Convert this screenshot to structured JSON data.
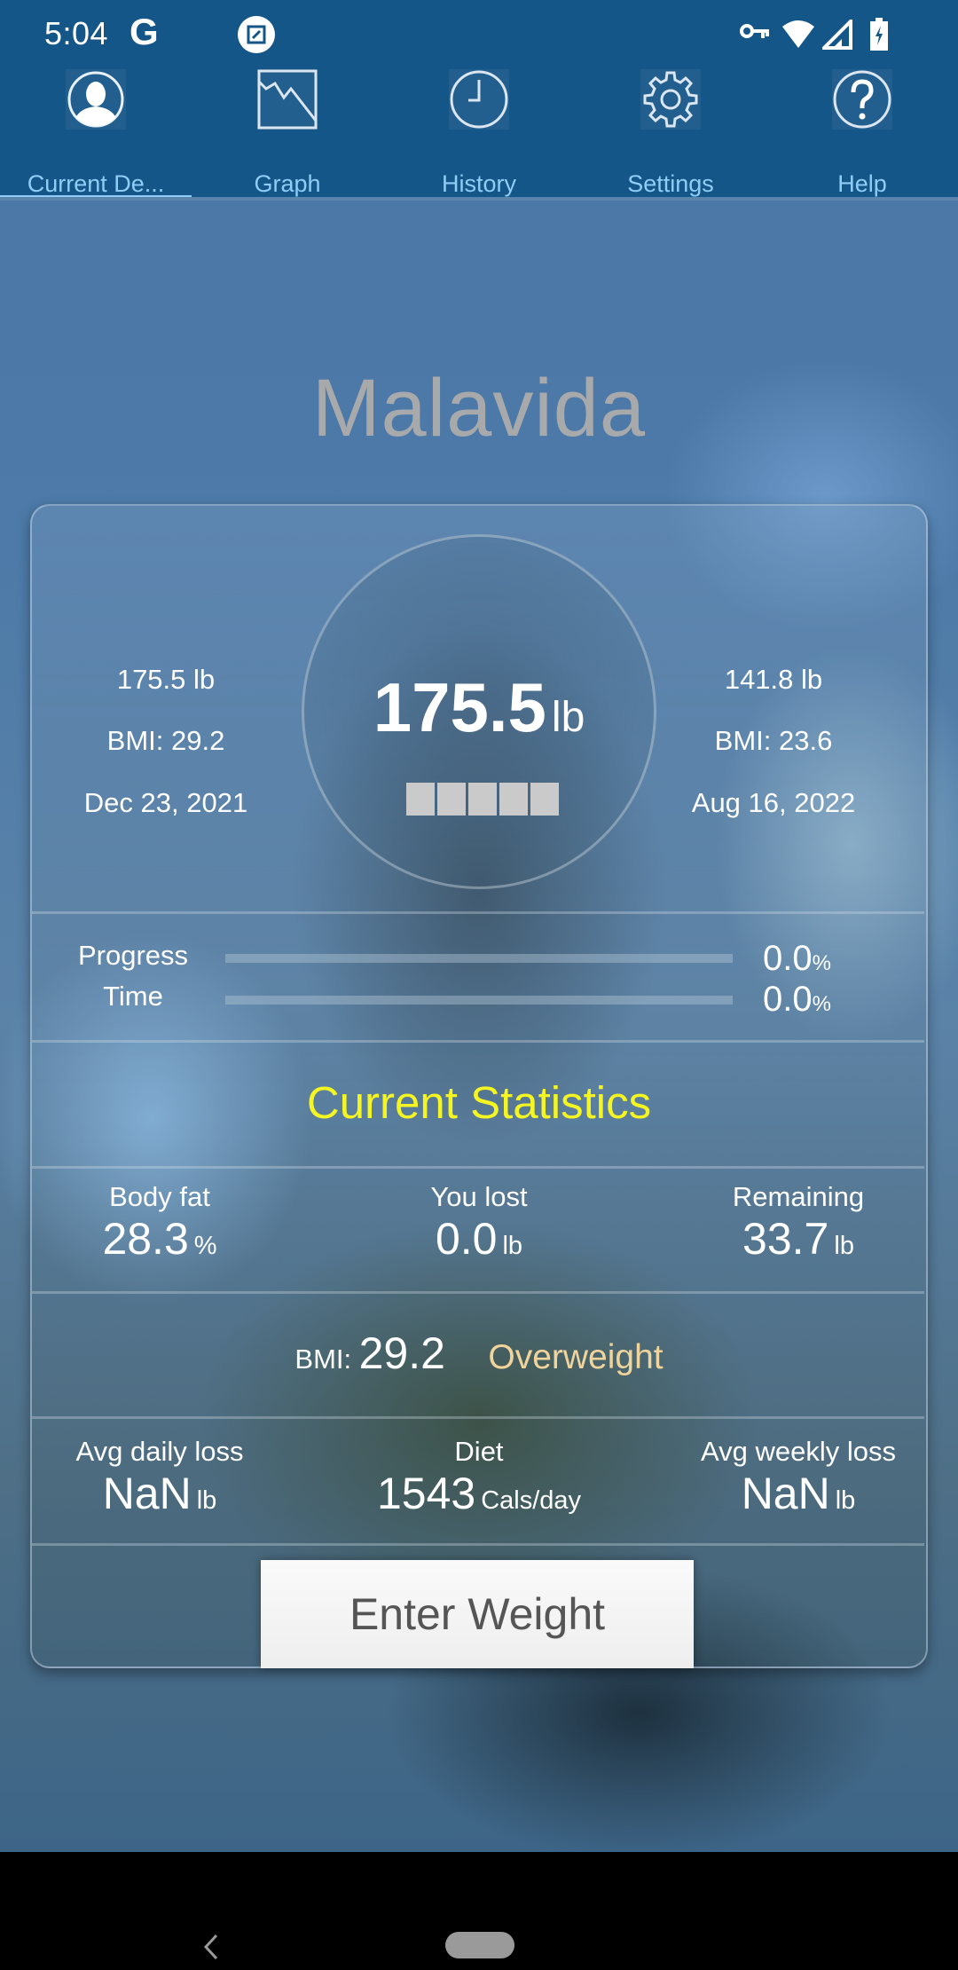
{
  "status_bar": {
    "time": "5:04",
    "left_icons": [
      "google-g-icon",
      "screenshot-edit-icon"
    ],
    "right_icons": [
      "vpn-key-icon",
      "wifi-icon",
      "cell-signal-icon",
      "battery-charging-icon"
    ],
    "google_glyph": "G"
  },
  "tabs": [
    {
      "label": "Current De...",
      "icon": "user-profile-icon",
      "active": true
    },
    {
      "label": "Graph",
      "icon": "line-graph-icon",
      "active": false
    },
    {
      "label": "History",
      "icon": "clock-icon",
      "active": false
    },
    {
      "label": "Settings",
      "icon": "gear-icon",
      "active": false
    },
    {
      "label": "Help",
      "icon": "help-icon",
      "active": false
    }
  ],
  "profile": {
    "name": "Malavida"
  },
  "summary": {
    "start": {
      "weight": "175.5 lb",
      "bmi": "BMI: 29.2",
      "date": "Dec 23, 2021"
    },
    "current": {
      "weight": "175.5",
      "unit": "lb",
      "blocks": 5
    },
    "goal": {
      "weight": "141.8 lb",
      "bmi": "BMI: 23.6",
      "date": "Aug 16, 2022"
    }
  },
  "progress": {
    "rows": [
      {
        "label": "Progress",
        "value": "0.0",
        "unit": "%",
        "fraction": 0.0
      },
      {
        "label": "Time",
        "value": "0.0",
        "unit": "%",
        "fraction": 0.0
      }
    ]
  },
  "stats": {
    "title": "Current Statistics",
    "body_fat": {
      "label": "Body fat",
      "value": "28.3",
      "unit": "%"
    },
    "you_lost": {
      "label": "You lost",
      "value": "0.0",
      "unit": "lb"
    },
    "remaining": {
      "label": "Remaining",
      "value": "33.7",
      "unit": "lb"
    },
    "bmi": {
      "label": "BMI:",
      "value": "29.2",
      "category": "Overweight"
    },
    "avg_daily_loss": {
      "label": "Avg daily loss",
      "value": "NaN",
      "unit": "lb"
    },
    "diet": {
      "label": "Diet",
      "value": "1543",
      "unit": "Cals/day"
    },
    "avg_weekly_loss": {
      "label": "Avg weekly loss",
      "value": "NaN",
      "unit": "lb"
    }
  },
  "actions": {
    "enter_weight_label": "Enter Weight"
  },
  "colors": {
    "header": "#155689",
    "tab_text": "#8fcdf6",
    "section_title": "#f5f522",
    "bmi_category": "#f1d49b",
    "title_text": "#a7a9ab"
  }
}
